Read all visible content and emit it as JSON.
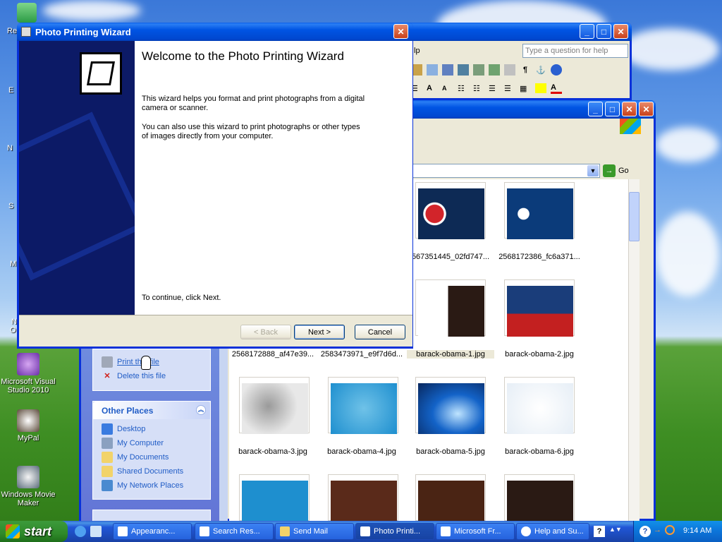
{
  "desktop": {
    "icons": [
      {
        "label": "Microsoft Visual Studio 2010"
      },
      {
        "label": "MyPal"
      },
      {
        "label": "Windows Movie Maker"
      }
    ],
    "cut_labels": [
      "Re",
      "E",
      "N",
      "S",
      "M",
      "N",
      "O"
    ]
  },
  "wizard": {
    "title": "Photo Printing Wizard",
    "heading": "Welcome to the Photo Printing Wizard",
    "paragraph1": "This wizard helps you format and print photographs from a digital camera or scanner.",
    "paragraph2": "You can also use this wizard to print photographs or other types of images directly from your computer.",
    "continue_text": "To continue, click Next.",
    "back_label": "< Back",
    "next_label": "Next >",
    "cancel_label": "Cancel"
  },
  "word": {
    "help_fragment": "lp",
    "question_placeholder": "Type a question for help"
  },
  "explorer": {
    "go_label": "Go",
    "task_items": [
      {
        "label": "Print this file",
        "icon": "printer-icon"
      },
      {
        "label": "Delete this file",
        "icon": "delete-icon"
      }
    ],
    "other_places_title": "Other Places",
    "other_places": [
      {
        "label": "Desktop",
        "icon": "desktop-icon"
      },
      {
        "label": "My Computer",
        "icon": "computer-icon"
      },
      {
        "label": "My Documents",
        "icon": "folder-icon"
      },
      {
        "label": "Shared Documents",
        "icon": "folder-icon"
      },
      {
        "label": "My Network Places",
        "icon": "network-icon"
      }
    ],
    "thumbnails": [
      {
        "label": "567351445_02fd747..."
      },
      {
        "label": "2568172386_fc6a371..."
      },
      {
        "label": "2568172888_af47e39..."
      },
      {
        "label": "2583473971_e9f7d6d..."
      },
      {
        "label": "barack-obama-1.jpg"
      },
      {
        "label": "barack-obama-2.jpg"
      },
      {
        "label": "barack-obama-3.jpg"
      },
      {
        "label": "barack-obama-4.jpg"
      },
      {
        "label": "barack-obama-5.jpg"
      },
      {
        "label": "barack-obama-6.jpg"
      }
    ]
  },
  "taskbar": {
    "start_label": "start",
    "items": [
      {
        "label": "Appearanc..."
      },
      {
        "label": "Search Res..."
      },
      {
        "label": "Send Mail"
      },
      {
        "label": "Photo Printi..."
      },
      {
        "label": "Microsoft Fr..."
      },
      {
        "label": "Help and Su..."
      }
    ],
    "clock": "9:14 AM"
  },
  "colors": {
    "title_blue": "#0054e3",
    "wizard_left": "#0c1a66",
    "link_blue": "#215dc6",
    "start_green": "#2f8a2a"
  }
}
